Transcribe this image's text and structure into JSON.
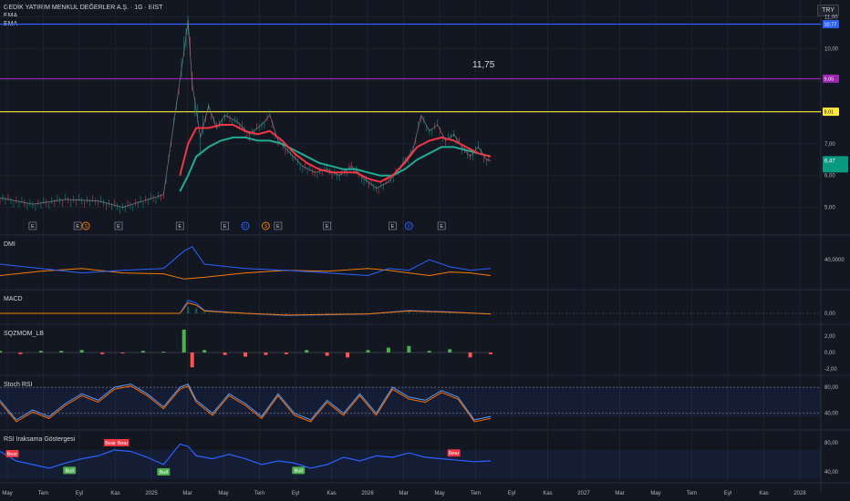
{
  "header": {
    "symbol_title": "GEDİK YATIRIM MENKUL DEĞERLER A.Ş. · 1G · BIST",
    "indicator_1": "EMA",
    "indicator_2": "EMA",
    "currency": "TRY"
  },
  "colors": {
    "background": "#131722",
    "grid": "#1e222d",
    "ema_fast": "#f23645",
    "ema_slow": "#22ab94",
    "blue_line": "#2962ff",
    "magenta_line": "#9c27b0",
    "yellow_line": "#ffeb3b",
    "dmi_plus": "#2962ff",
    "dmi_minus": "#f57c00",
    "stoch_k": "#5b9cf6",
    "stoch_d": "#ff6d00",
    "rsi": "#2962ff",
    "up": "#089981",
    "down": "#f23645"
  },
  "chart_data": [
    {
      "type": "line",
      "name": "price",
      "y_ticks": [
        "11,00",
        "10,00",
        "9,00",
        "8,00",
        "7,00",
        "6,00",
        "5,00"
      ],
      "ylim": [
        4.3,
        11.3
      ],
      "annotation": "11,75",
      "hlines": [
        {
          "value": 10.77,
          "label": "10,77",
          "color": "#2962ff"
        },
        {
          "value": 9.05,
          "label": "9,05",
          "color": "#9c27b0"
        },
        {
          "value": 8.01,
          "label": "8,01",
          "color": "#ffeb3b"
        }
      ],
      "last_price": {
        "value": 6.47,
        "label": "6,47"
      },
      "x_months": [
        "May",
        "Tem",
        "Eyl",
        "Kas",
        "2025",
        "Mar",
        "May",
        "Tem",
        "Eyl",
        "Kas",
        "2026",
        "Mar",
        "May",
        "Tem",
        "Eyl",
        "Kas",
        "2027",
        "Mar",
        "May",
        "Tem",
        "Eyl",
        "Kas",
        "2028"
      ],
      "price_path": [
        [
          0,
          5.3
        ],
        [
          8,
          5.1
        ],
        [
          16,
          5.25
        ],
        [
          24,
          5.2
        ],
        [
          30,
          5.0
        ],
        [
          35,
          5.2
        ],
        [
          40,
          5.4
        ],
        [
          45,
          9.9
        ],
        [
          46,
          10.9
        ],
        [
          47,
          8.9
        ],
        [
          49,
          7.2
        ],
        [
          51,
          8.2
        ],
        [
          53,
          7.5
        ],
        [
          55,
          7.9
        ],
        [
          58,
          7.7
        ],
        [
          61,
          7.3
        ],
        [
          64,
          7.6
        ],
        [
          66,
          7.9
        ],
        [
          68,
          7.1
        ],
        [
          71,
          6.7
        ],
        [
          74,
          6.3
        ],
        [
          77,
          6.1
        ],
        [
          80,
          6.2
        ],
        [
          83,
          6.0
        ],
        [
          86,
          6.3
        ],
        [
          89,
          5.9
        ],
        [
          92,
          5.6
        ],
        [
          95,
          5.8
        ],
        [
          98,
          6.3
        ],
        [
          101,
          6.8
        ],
        [
          103,
          7.9
        ],
        [
          105,
          7.4
        ],
        [
          107,
          7.6
        ],
        [
          109,
          7.1
        ],
        [
          111,
          7.3
        ],
        [
          113,
          6.9
        ],
        [
          115,
          6.6
        ],
        [
          117,
          6.9
        ],
        [
          119,
          6.5
        ],
        [
          120,
          6.47
        ]
      ],
      "ema_fast": [
        [
          44,
          6.0
        ],
        [
          46,
          7.0
        ],
        [
          48,
          7.5
        ],
        [
          51,
          7.5
        ],
        [
          54,
          7.6
        ],
        [
          57,
          7.6
        ],
        [
          60,
          7.4
        ],
        [
          63,
          7.3
        ],
        [
          66,
          7.4
        ],
        [
          69,
          7.1
        ],
        [
          72,
          6.7
        ],
        [
          75,
          6.4
        ],
        [
          78,
          6.2
        ],
        [
          81,
          6.1
        ],
        [
          84,
          6.1
        ],
        [
          87,
          6.1
        ],
        [
          90,
          5.9
        ],
        [
          93,
          5.8
        ],
        [
          96,
          6.0
        ],
        [
          99,
          6.4
        ],
        [
          102,
          6.9
        ],
        [
          105,
          7.1
        ],
        [
          108,
          7.2
        ],
        [
          111,
          7.1
        ],
        [
          114,
          6.9
        ],
        [
          117,
          6.7
        ],
        [
          120,
          6.6
        ]
      ],
      "ema_slow": [
        [
          44,
          5.5
        ],
        [
          46,
          6.0
        ],
        [
          48,
          6.6
        ],
        [
          51,
          6.9
        ],
        [
          54,
          7.1
        ],
        [
          57,
          7.2
        ],
        [
          60,
          7.2
        ],
        [
          63,
          7.1
        ],
        [
          66,
          7.1
        ],
        [
          69,
          7.0
        ],
        [
          72,
          6.8
        ],
        [
          75,
          6.6
        ],
        [
          78,
          6.4
        ],
        [
          81,
          6.3
        ],
        [
          84,
          6.2
        ],
        [
          87,
          6.2
        ],
        [
          90,
          6.1
        ],
        [
          93,
          6.0
        ],
        [
          96,
          6.0
        ],
        [
          99,
          6.2
        ],
        [
          102,
          6.5
        ],
        [
          105,
          6.7
        ],
        [
          108,
          6.9
        ],
        [
          111,
          6.9
        ],
        [
          114,
          6.8
        ],
        [
          117,
          6.7
        ],
        [
          120,
          6.6
        ]
      ],
      "event_markers": [
        {
          "x": 8,
          "label": "E",
          "kind": "earnings"
        },
        {
          "x": 19,
          "label": "E",
          "kind": "earnings"
        },
        {
          "x": 21,
          "label": "S",
          "kind": "split"
        },
        {
          "x": 29,
          "label": "E",
          "kind": "earnings"
        },
        {
          "x": 44,
          "label": "E",
          "kind": "earnings"
        },
        {
          "x": 55,
          "label": "E",
          "kind": "earnings"
        },
        {
          "x": 60,
          "label": "D",
          "kind": "dividend"
        },
        {
          "x": 65,
          "label": "S",
          "kind": "split"
        },
        {
          "x": 68,
          "label": "E",
          "kind": "earnings"
        },
        {
          "x": 80,
          "label": "E",
          "kind": "earnings"
        },
        {
          "x": 96,
          "label": "E",
          "kind": "earnings"
        },
        {
          "x": 100,
          "label": "D",
          "kind": "dividend"
        },
        {
          "x": 108,
          "label": "E",
          "kind": "earnings"
        }
      ]
    },
    {
      "type": "line",
      "name": "DMI",
      "y_ticks": [
        "40,0000"
      ],
      "series_plus": [
        [
          0,
          35
        ],
        [
          10,
          30
        ],
        [
          20,
          25
        ],
        [
          30,
          28
        ],
        [
          40,
          30
        ],
        [
          45,
          50
        ],
        [
          47,
          55
        ],
        [
          50,
          35
        ],
        [
          60,
          30
        ],
        [
          70,
          28
        ],
        [
          80,
          25
        ],
        [
          90,
          22
        ],
        [
          95,
          30
        ],
        [
          100,
          28
        ],
        [
          105,
          40
        ],
        [
          110,
          32
        ],
        [
          115,
          28
        ],
        [
          120,
          30
        ]
      ],
      "series_minus": [
        [
          0,
          22
        ],
        [
          10,
          27
        ],
        [
          20,
          30
        ],
        [
          30,
          25
        ],
        [
          40,
          24
        ],
        [
          45,
          18
        ],
        [
          50,
          20
        ],
        [
          60,
          25
        ],
        [
          70,
          28
        ],
        [
          80,
          27
        ],
        [
          90,
          30
        ],
        [
          95,
          28
        ],
        [
          100,
          25
        ],
        [
          105,
          22
        ],
        [
          110,
          26
        ],
        [
          115,
          25
        ],
        [
          120,
          22
        ]
      ]
    },
    {
      "type": "line",
      "name": "MACD",
      "y_ticks": [
        "0,00"
      ],
      "series": [
        [
          0,
          0
        ],
        [
          44,
          0
        ],
        [
          46,
          0.9
        ],
        [
          48,
          0.7
        ],
        [
          50,
          0.2
        ],
        [
          55,
          0.1
        ],
        [
          60,
          0.0
        ],
        [
          70,
          -0.15
        ],
        [
          80,
          -0.1
        ],
        [
          90,
          -0.05
        ],
        [
          100,
          0.2
        ],
        [
          110,
          0.1
        ],
        [
          120,
          -0.05
        ]
      ]
    },
    {
      "type": "bar",
      "name": "SQZMOM_LB",
      "y_ticks": [
        "2,00",
        "0,00",
        "-2,00"
      ],
      "values_x": [
        [
          0,
          0.2
        ],
        [
          5,
          -0.2
        ],
        [
          10,
          0.2
        ],
        [
          15,
          0.2
        ],
        [
          20,
          0.3
        ],
        [
          25,
          -0.2
        ],
        [
          30,
          -0.1
        ],
        [
          35,
          0.2
        ],
        [
          40,
          0.1
        ],
        [
          45,
          2.8
        ],
        [
          47,
          -1.8
        ],
        [
          50,
          0.3
        ],
        [
          55,
          -0.3
        ],
        [
          60,
          -0.5
        ],
        [
          65,
          -0.3
        ],
        [
          70,
          -0.2
        ],
        [
          75,
          0.3
        ],
        [
          80,
          -0.4
        ],
        [
          85,
          -0.6
        ],
        [
          90,
          0.3
        ],
        [
          95,
          0.6
        ],
        [
          100,
          0.8
        ],
        [
          105,
          0.2
        ],
        [
          110,
          0.4
        ],
        [
          115,
          -0.6
        ],
        [
          120,
          -0.2
        ]
      ]
    },
    {
      "type": "line",
      "name": "Stoch RSI",
      "y_ticks": [
        "80,00",
        "40,00"
      ],
      "series": [
        [
          0,
          60
        ],
        [
          4,
          30
        ],
        [
          8,
          45
        ],
        [
          12,
          35
        ],
        [
          16,
          55
        ],
        [
          20,
          70
        ],
        [
          24,
          60
        ],
        [
          28,
          80
        ],
        [
          32,
          85
        ],
        [
          36,
          70
        ],
        [
          40,
          50
        ],
        [
          44,
          80
        ],
        [
          46,
          85
        ],
        [
          48,
          60
        ],
        [
          52,
          40
        ],
        [
          56,
          70
        ],
        [
          60,
          55
        ],
        [
          64,
          35
        ],
        [
          68,
          70
        ],
        [
          72,
          40
        ],
        [
          76,
          30
        ],
        [
          80,
          60
        ],
        [
          84,
          40
        ],
        [
          88,
          70
        ],
        [
          92,
          40
        ],
        [
          96,
          80
        ],
        [
          100,
          65
        ],
        [
          104,
          60
        ],
        [
          108,
          75
        ],
        [
          112,
          65
        ],
        [
          116,
          30
        ],
        [
          120,
          35
        ]
      ]
    },
    {
      "type": "line",
      "name": "RSI Iraksama Göstergesi",
      "y_ticks": [
        "80,00",
        "40,00"
      ],
      "series": [
        [
          0,
          68
        ],
        [
          4,
          55
        ],
        [
          8,
          50
        ],
        [
          12,
          45
        ],
        [
          16,
          52
        ],
        [
          20,
          58
        ],
        [
          24,
          62
        ],
        [
          28,
          70
        ],
        [
          32,
          68
        ],
        [
          36,
          60
        ],
        [
          40,
          50
        ],
        [
          44,
          78
        ],
        [
          46,
          75
        ],
        [
          48,
          62
        ],
        [
          52,
          58
        ],
        [
          56,
          64
        ],
        [
          60,
          58
        ],
        [
          64,
          50
        ],
        [
          68,
          55
        ],
        [
          72,
          52
        ],
        [
          76,
          45
        ],
        [
          80,
          50
        ],
        [
          84,
          60
        ],
        [
          88,
          55
        ],
        [
          92,
          62
        ],
        [
          96,
          60
        ],
        [
          100,
          66
        ],
        [
          104,
          60
        ],
        [
          108,
          58
        ],
        [
          112,
          56
        ],
        [
          116,
          54
        ],
        [
          120,
          55
        ]
      ],
      "labels": [
        {
          "x": 3,
          "text": "Bear",
          "kind": "bear"
        },
        {
          "x": 17,
          "text": "Bull",
          "kind": "bull"
        },
        {
          "x": 27,
          "text": "Bear",
          "kind": "bear"
        },
        {
          "x": 30,
          "text": "Bear",
          "kind": "bear"
        },
        {
          "x": 40,
          "text": "Bull",
          "kind": "bull"
        },
        {
          "x": 73,
          "text": "Bull",
          "kind": "bull"
        },
        {
          "x": 111,
          "text": "Bear",
          "kind": "bear"
        }
      ]
    }
  ]
}
